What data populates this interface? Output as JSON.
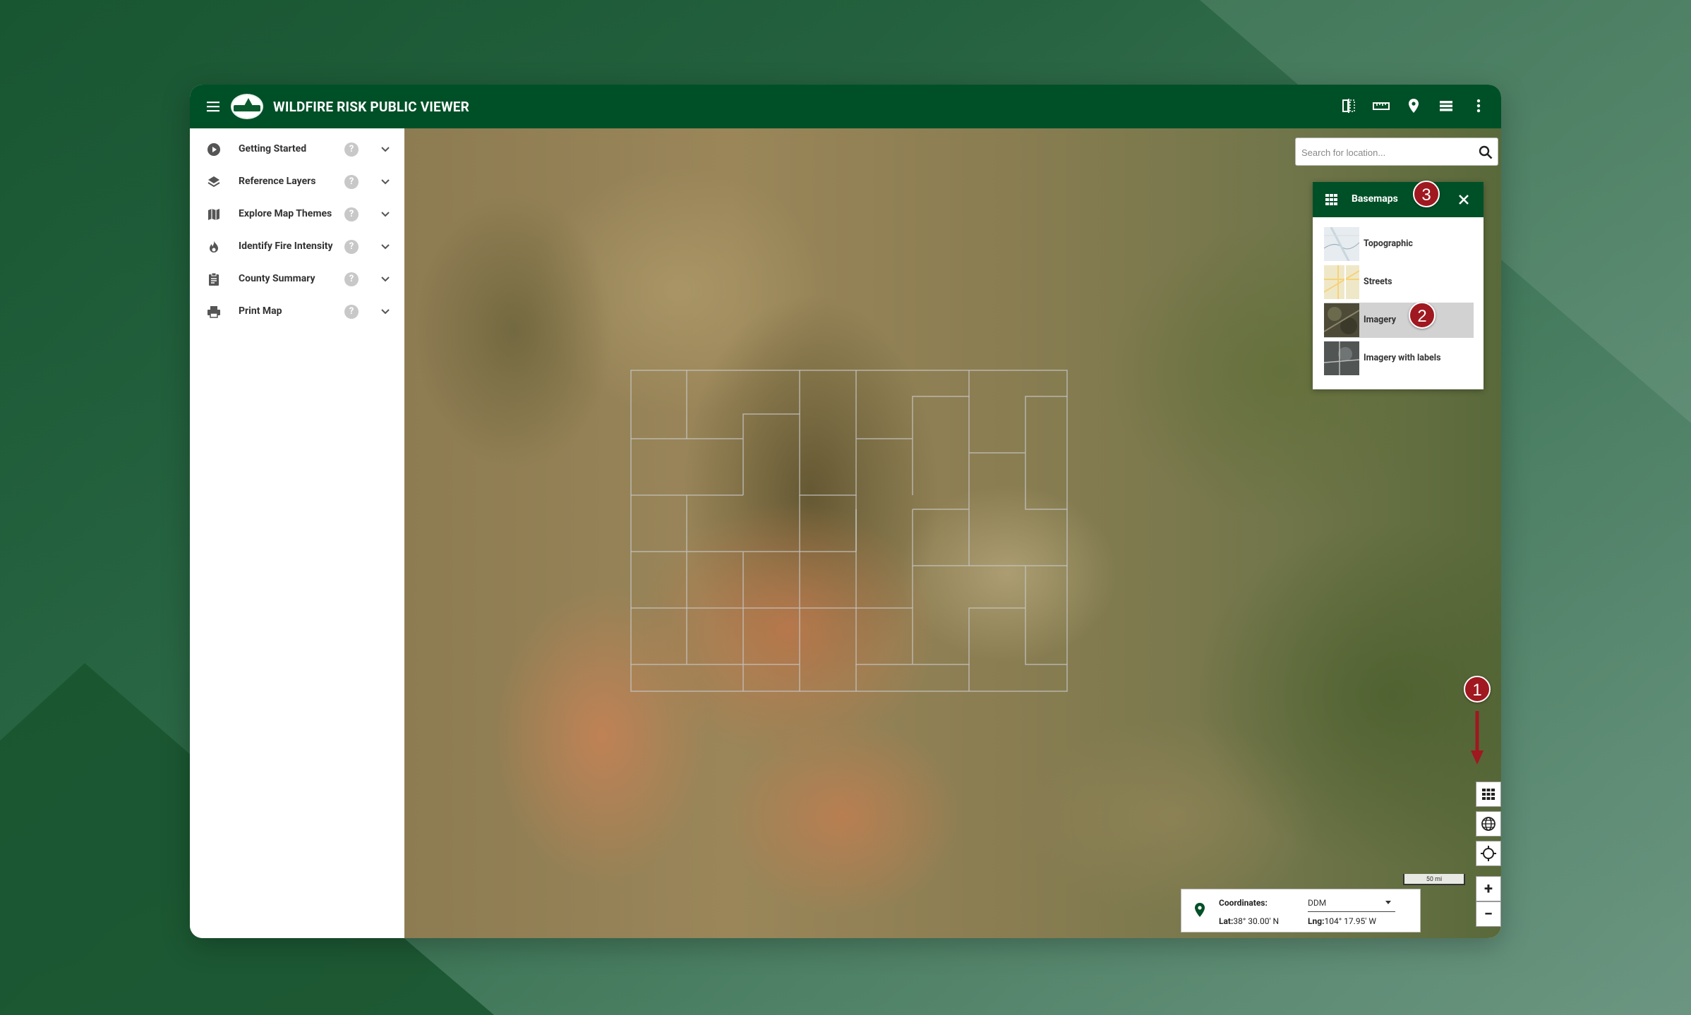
{
  "header": {
    "title": "WILDFIRE RISK PUBLIC VIEWER",
    "icons": [
      "compare-icon",
      "measure-icon",
      "location-pin-icon",
      "layer-list-icon",
      "more-vert-icon"
    ]
  },
  "sidebar": {
    "items": [
      {
        "label": "Getting Started",
        "icon": "play-circle-icon"
      },
      {
        "label": "Reference Layers",
        "icon": "layers-icon"
      },
      {
        "label": "Explore Map Themes",
        "icon": "map-icon"
      },
      {
        "label": "Identify Fire Intensity",
        "icon": "fire-icon"
      },
      {
        "label": "County Summary",
        "icon": "clipboard-icon"
      },
      {
        "label": "Print Map",
        "icon": "printer-icon"
      }
    ],
    "help_glyph": "?"
  },
  "search": {
    "placeholder": "Search for location..."
  },
  "basemaps": {
    "title": "Basemaps",
    "items": [
      {
        "label": "Topographic"
      },
      {
        "label": "Streets"
      },
      {
        "label": "Imagery",
        "selected": true
      },
      {
        "label": "Imagery with labels"
      }
    ]
  },
  "badges": {
    "one": "1",
    "two": "2",
    "three": "3"
  },
  "map_controls": {
    "zoom_in": "+",
    "zoom_out": "−"
  },
  "scale": {
    "label": "50 mi"
  },
  "coordinates": {
    "label": "Coordinates:",
    "format": "DDM",
    "lat_label": "Lat:",
    "lat_value": "38° 30.00' N",
    "lng_label": "Lng:",
    "lng_value": "104° 17.95' W"
  },
  "colors": {
    "header_green": "#005027",
    "badge_red": "#a01820",
    "selected_gray": "#d2d2d2"
  }
}
